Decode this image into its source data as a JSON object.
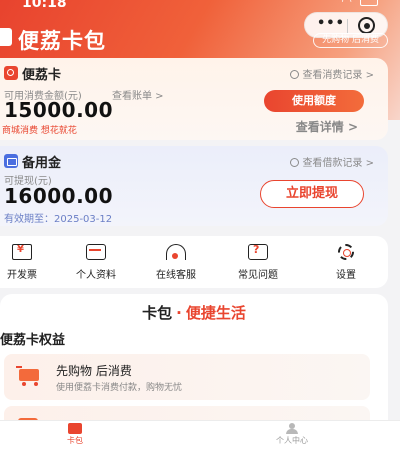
{
  "status_bar": {
    "time": "10:18"
  },
  "header": {
    "title": "便荔卡包",
    "slogan": "先购物 后消费",
    "capsule_more": "•••"
  },
  "card1": {
    "title": "便荔卡",
    "record_link": "查看消费记录 >",
    "available_label": "可用消费金额(元)",
    "bill_link": "查看账单 >",
    "amount": "15000.00",
    "slogan": "商城消费 想花就花",
    "use_button": "使用额度",
    "detail_link": "查看详情 >"
  },
  "card2": {
    "title": "备用金",
    "record_link": "查看借款记录 >",
    "available_label": "可提现(元)",
    "amount": "16000.00",
    "validity": "有效期至：2025-03-12",
    "withdraw_button": "立即提现"
  },
  "quick_actions": [
    {
      "label": "开发票",
      "icon": "invoice-icon"
    },
    {
      "label": "个人资料",
      "icon": "profile-card-icon"
    },
    {
      "label": "在线客服",
      "icon": "headset-icon"
    },
    {
      "label": "常见问题",
      "icon": "faq-icon"
    },
    {
      "label": "设置",
      "icon": "gear-icon"
    }
  ],
  "pack_section": {
    "head_left": "卡包",
    "head_dot": "·",
    "head_right": "便捷生活",
    "rights_title": "便荔卡权益",
    "rights": [
      {
        "title": "先购物 后消费",
        "desc": "使用便荔卡消费付款，购物无忧",
        "icon": "shopping-cart-icon"
      },
      {
        "title": "",
        "icon": "rights-icon"
      }
    ]
  },
  "tabbar": {
    "tabs": [
      {
        "label": "卡包",
        "active": true,
        "icon": "card-wallet-icon"
      },
      {
        "label": "个人中心",
        "active": false,
        "icon": "user-icon"
      }
    ]
  },
  "colors": {
    "brand": "#e9452f",
    "brand_light": "#f36c3b",
    "blue_accent": "#4a6ee0"
  }
}
